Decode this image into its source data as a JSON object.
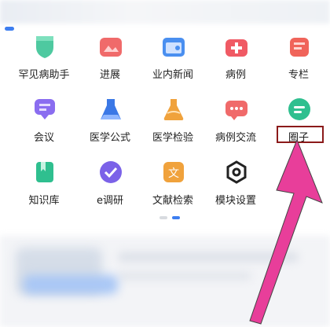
{
  "grid": {
    "rows": [
      [
        {
          "name": "rare-disease-helper",
          "label": "罕见病助手",
          "icon": "shield-icon",
          "color": "#2fbf8f"
        },
        {
          "name": "progress",
          "label": "进展",
          "icon": "image-icon",
          "color": "#f06a6a"
        },
        {
          "name": "industry-news",
          "label": "业内新闻",
          "icon": "calendar-icon",
          "color": "#4a8ff0"
        },
        {
          "name": "cases",
          "label": "病例",
          "icon": "medical-kit-icon",
          "color": "#f05a64"
        },
        {
          "name": "columns",
          "label": "专栏",
          "icon": "column-icon",
          "color": "#f0645a"
        }
      ],
      [
        {
          "name": "meeting",
          "label": "会议",
          "icon": "chat-bubble-icon",
          "color": "#8a6df0"
        },
        {
          "name": "medical-formula",
          "label": "医学公式",
          "icon": "flask-icon",
          "color": "#3b78e6"
        },
        {
          "name": "medical-tests",
          "label": "医学检验",
          "icon": "beaker-icon",
          "color": "#f0a23c"
        },
        {
          "name": "case-exchange",
          "label": "病例交流",
          "icon": "message-icon",
          "color": "#f06a6a"
        },
        {
          "name": "circle",
          "label": "圈子",
          "icon": "chat-icon",
          "color": "#2fbf8f"
        }
      ],
      [
        {
          "name": "knowledge-base",
          "label": "知识库",
          "icon": "bookmark-icon",
          "color": "#2fbf8f"
        },
        {
          "name": "e-survey",
          "label": "e调研",
          "icon": "check-icon",
          "color": "#7b62e8"
        },
        {
          "name": "literature-search",
          "label": "文献检索",
          "icon": "document-icon",
          "color": "#f0a23c"
        },
        {
          "name": "module-settings",
          "label": "模块设置",
          "icon": "hexagon-icon",
          "color": "#222222"
        }
      ]
    ]
  },
  "pager": {
    "current": 2,
    "total": 2
  },
  "colors": {
    "accent": "#3d7ef0",
    "highlight": "#8b1a1a",
    "arrow": "#e83e9a"
  }
}
